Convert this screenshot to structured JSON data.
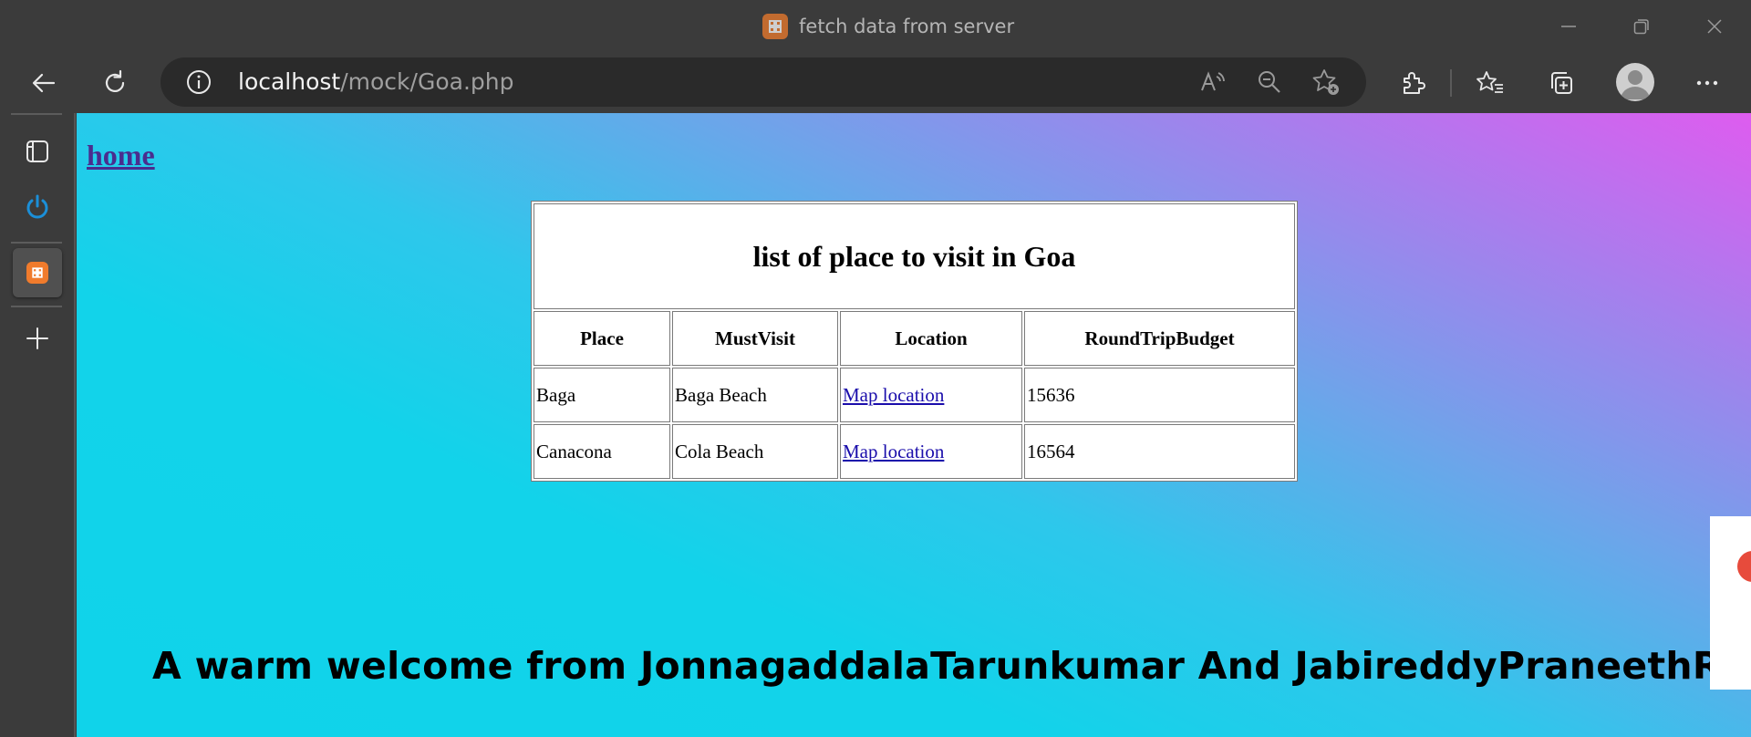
{
  "window": {
    "title": "fetch data from server"
  },
  "address": {
    "host": "localhost",
    "path": "/mock/Goa.php"
  },
  "page": {
    "home_link": "home",
    "table": {
      "caption": "list of place to visit in Goa",
      "headers": [
        "Place",
        "MustVisit",
        "Location",
        "RoundTripBudget"
      ],
      "rows": [
        {
          "place": "Baga",
          "must_visit": "Baga Beach",
          "location": "Map location",
          "budget": "15636"
        },
        {
          "place": "Canacona",
          "must_visit": "Cola Beach",
          "location": "Map location",
          "budget": "16564"
        }
      ]
    },
    "welcome": "A warm welcome from JonnagaddalaTarunkumar And JabireddyPraneethReddy"
  },
  "icons": {
    "back": "back-arrow-icon",
    "refresh": "refresh-icon",
    "info": "info-icon",
    "read_aloud": "read-aloud-icon",
    "zoom": "zoom-out-icon",
    "favorite_add": "add-favorite-icon",
    "extensions": "extensions-icon",
    "favorites": "favorites-icon",
    "collections": "collections-icon",
    "more": "more-icon"
  },
  "colors": {
    "chrome": "#3b3b3b",
    "address_bar": "#2a2a2a",
    "gradient_top_right": "#de5cef",
    "gradient_bottom_left": "#10d3ea",
    "link": "#1a0dab"
  }
}
